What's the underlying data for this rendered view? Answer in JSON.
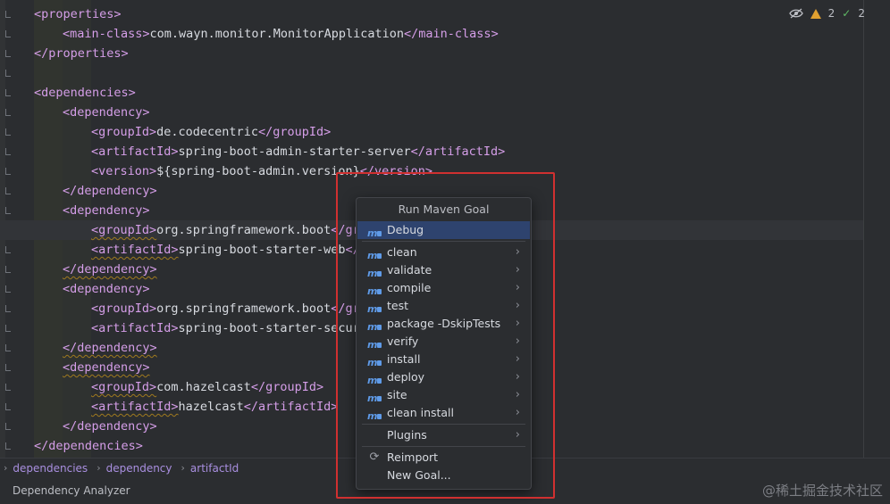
{
  "editor": {
    "lines": [
      {
        "indent": 1,
        "open": "<properties>",
        "text": "",
        "close": ""
      },
      {
        "indent": 2,
        "open": "<main-class>",
        "text": "com.wayn.monitor.MonitorApplication",
        "close": "</main-class>"
      },
      {
        "indent": 1,
        "open": "</properties>",
        "text": "",
        "close": ""
      },
      {
        "indent": 0,
        "open": "",
        "text": "",
        "close": ""
      },
      {
        "indent": 1,
        "open": "<dependencies>",
        "text": "",
        "close": ""
      },
      {
        "indent": 2,
        "open": "<dependency>",
        "text": "",
        "close": ""
      },
      {
        "indent": 3,
        "open": "<groupId>",
        "text": "de.codecentric",
        "close": "</groupId>"
      },
      {
        "indent": 3,
        "open": "<artifactId>",
        "text": "spring-boot-admin-starter-server",
        "close": "</artifactId>"
      },
      {
        "indent": 3,
        "open": "<version>",
        "text": "${spring-boot-admin.version}",
        "close": "</version>"
      },
      {
        "indent": 2,
        "open": "</dependency>",
        "text": "",
        "close": ""
      },
      {
        "indent": 2,
        "open": "<dependency>",
        "text": "",
        "close": ""
      },
      {
        "indent": 3,
        "open": "<groupId>",
        "text": "org.springframework.boot",
        "close": "</gr"
      },
      {
        "indent": 3,
        "open": "<artifactId>",
        "text": "spring-boot-starter-web",
        "close": "</"
      },
      {
        "indent": 2,
        "open": "</dependency>",
        "text": "",
        "close": ""
      },
      {
        "indent": 2,
        "open": "<dependency>",
        "text": "",
        "close": ""
      },
      {
        "indent": 3,
        "open": "<groupId>",
        "text": "org.springframework.boot",
        "close": "</gr"
      },
      {
        "indent": 3,
        "open": "<artifactId>",
        "text": "spring-boot-starter-secur",
        "close": ""
      },
      {
        "indent": 2,
        "open": "</dependency>",
        "text": "",
        "close": ""
      },
      {
        "indent": 2,
        "open": "<dependency>",
        "text": "",
        "close": ""
      },
      {
        "indent": 3,
        "open": "<groupId>",
        "text": "com.hazelcast",
        "close": "</groupId>"
      },
      {
        "indent": 3,
        "open": "<artifactId>",
        "text": "hazelcast",
        "close": "</artifactId>"
      },
      {
        "indent": 2,
        "open": "</dependency>",
        "text": "",
        "close": ""
      },
      {
        "indent": 1,
        "open": "</dependencies>",
        "text": "",
        "close": ""
      }
    ],
    "warn_lines": [
      12,
      13,
      14,
      18,
      19,
      20,
      21
    ],
    "current_line": 12
  },
  "inspections": {
    "warnings": "2",
    "checks": "2"
  },
  "popup": {
    "title": "Run Maven Goal",
    "selected": "Debug",
    "goals": [
      "clean",
      "validate",
      "compile",
      "test",
      "package -DskipTests",
      "verify",
      "install",
      "deploy",
      "site",
      "clean install"
    ],
    "plugins": "Plugins",
    "reimport": "Reimport",
    "new_goal": "New Goal..."
  },
  "breadcrumb": [
    "dependencies",
    "dependency",
    "artifactId"
  ],
  "status": {
    "label": "Dependency Analyzer"
  },
  "watermark": "@稀土掘金技术社区",
  "colors": {
    "tag": "#d59ee8",
    "text": "#d7dae0",
    "selection": "#2e436e",
    "highlight_box": "#d03030",
    "crumb": "#a98fe0"
  }
}
